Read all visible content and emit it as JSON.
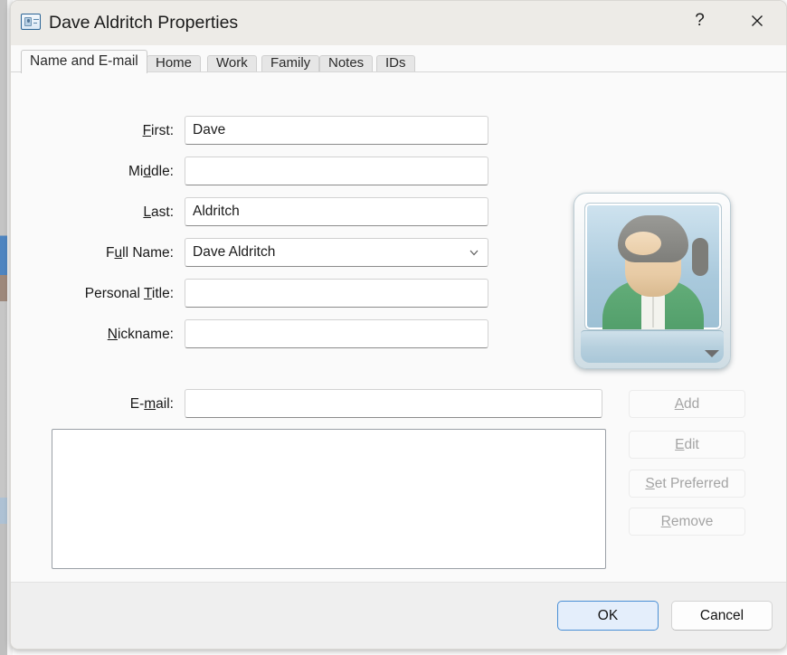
{
  "window": {
    "title": "Dave Aldritch Properties",
    "icon": "contact-card-icon",
    "help_label": "?",
    "close_label": "✕"
  },
  "tabs": [
    {
      "label": "Name and E-mail",
      "active": true
    },
    {
      "label": "Home",
      "active": false
    },
    {
      "label": "Work",
      "active": false
    },
    {
      "label": "Family",
      "active": false
    },
    {
      "label": "Notes",
      "active": false
    },
    {
      "label": "IDs",
      "active": false
    }
  ],
  "fields": {
    "first": {
      "label": "First:",
      "accel": "F",
      "value": "Dave",
      "placeholder": ""
    },
    "middle": {
      "label": "Middle:",
      "accel": "d",
      "value": "",
      "placeholder": ""
    },
    "last": {
      "label": "Last:",
      "accel": "L",
      "value": "Aldritch",
      "placeholder": ""
    },
    "full_name": {
      "label": "Full Name:",
      "accel": "u",
      "value": "Dave Aldritch",
      "options": [
        "Dave Aldritch"
      ]
    },
    "personal_title": {
      "label": "Personal Title:",
      "accel": "T",
      "value": "",
      "placeholder": ""
    },
    "nickname": {
      "label": "Nickname:",
      "accel": "N",
      "value": "",
      "placeholder": ""
    },
    "email": {
      "label": "E-mail:",
      "accel": "m",
      "value": "",
      "placeholder": ""
    }
  },
  "email_list": {
    "items": []
  },
  "email_buttons": [
    {
      "label": "Add",
      "accel": "A",
      "enabled": false
    },
    {
      "label": "Edit",
      "accel": "E",
      "enabled": false
    },
    {
      "label": "Set Preferred",
      "accel": "S",
      "enabled": false
    },
    {
      "label": "Remove",
      "accel": "R",
      "enabled": false
    }
  ],
  "avatar": {
    "name": "contact-photo",
    "has_dropdown": true
  },
  "footer": {
    "ok_label": "OK",
    "cancel_label": "Cancel"
  },
  "colors": {
    "accent": "#4a8fd6",
    "titlebar": "#edebe7",
    "content": "#fafafa",
    "footer": "#efefef",
    "disabled_text": "#a4a4a4"
  }
}
